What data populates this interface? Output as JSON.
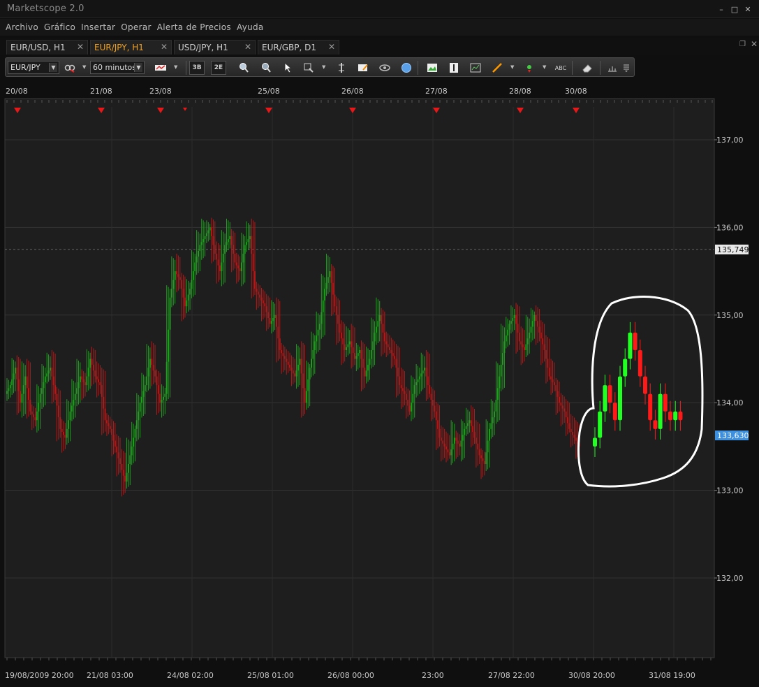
{
  "window": {
    "title": "Marketscope 2.0",
    "controls": [
      "–",
      "□",
      "✕"
    ]
  },
  "menu": [
    "Archivo",
    "Gráfico",
    "Insertar",
    "Operar",
    "Alerta de Precios",
    "Ayuda"
  ],
  "tabs": [
    {
      "label": "EUR/USD, H1",
      "active": false
    },
    {
      "label": "EUR/JPY, H1",
      "active": true
    },
    {
      "label": "USD/JPY, H1",
      "active": false
    },
    {
      "label": "EUR/GBP, D1",
      "active": false
    }
  ],
  "toolbar": {
    "instrument": "EUR/JPY",
    "timeframe": "60 minutos",
    "icons": [
      "link-icon",
      "candle-style-icon",
      "mode-1-icon",
      "mode-2-icon",
      "zoom-in-icon",
      "zoom-out-icon",
      "cursor-icon",
      "crosshair-icon",
      "data-box-icon",
      "note-icon",
      "eye-icon",
      "globe-icon",
      "image-icon",
      "text-icon",
      "indicator-icon",
      "pen-icon",
      "signal-icon",
      "abc-icon",
      "eraser-icon",
      "grid-icon",
      "menu-icon"
    ]
  },
  "chart_data": {
    "type": "candlestick",
    "instrument": "EUR/JPY",
    "timeframe": "H1",
    "ylim": [
      131.0,
      137.5
    ],
    "y_ticks": [
      "137,00",
      "136,00",
      "135,00",
      "134,00",
      "133,00",
      "132,00"
    ],
    "y_tick_values": [
      137.0,
      136.0,
      135.0,
      134.0,
      133.0,
      132.0
    ],
    "current_price_label": "133,630",
    "current_price": 133.63,
    "dashed_level_label": "135,749",
    "dashed_level": 135.749,
    "top_date_labels": [
      "20/08",
      "21/08",
      "23/08",
      "25/08",
      "26/08",
      "27/08",
      "28/08",
      "30/08"
    ],
    "bottom_time_labels": [
      "19/08/2009 20:00",
      "21/08 03:00",
      "24/08 02:00",
      "25/08 01:00",
      "26/08 00:00",
      "23:00",
      "27/08 22:00",
      "30/08 20:00",
      "31/08 19:00"
    ],
    "event_marker_count": 9,
    "colors": {
      "up": "#1f9e1f",
      "down": "#b01a1a",
      "bg": "#1e1e1e",
      "grid": "#333333",
      "highlight_up": "#22ff22",
      "highlight_down": "#ff1a1a",
      "circle": "#ffffff",
      "price_tag": "#3d8fe0"
    },
    "candles_closes": [
      134.2,
      134.4,
      134.0,
      134.3,
      133.9,
      133.8,
      134.1,
      134.3,
      134.4,
      134.1,
      133.7,
      133.6,
      133.9,
      134.1,
      134.3,
      134.2,
      134.5,
      134.3,
      134.2,
      133.8,
      133.7,
      133.5,
      133.3,
      133.1,
      133.4,
      133.7,
      134.0,
      134.2,
      134.5,
      134.3,
      134.0,
      134.1,
      135.2,
      135.5,
      135.4,
      135.1,
      135.3,
      135.6,
      135.8,
      135.9,
      136.0,
      135.7,
      135.5,
      135.8,
      135.9,
      135.6,
      135.5,
      135.8,
      135.9,
      135.3,
      135.2,
      135.1,
      134.9,
      135.0,
      134.6,
      134.5,
      134.4,
      134.3,
      134.5,
      134.0,
      134.4,
      134.7,
      134.9,
      135.3,
      135.5,
      135.1,
      134.8,
      134.6,
      134.7,
      134.5,
      134.6,
      134.3,
      134.5,
      134.8,
      135.0,
      134.7,
      134.6,
      134.5,
      134.2,
      134.1,
      133.9,
      134.2,
      134.3,
      134.4,
      134.1,
      133.9,
      133.6,
      133.5,
      133.4,
      133.6,
      133.5,
      133.7,
      133.8,
      133.6,
      133.4,
      133.3,
      133.7,
      133.9,
      134.3,
      134.7,
      134.9,
      135.0,
      134.7,
      134.6,
      134.8,
      135.0,
      134.8,
      134.6,
      134.3,
      134.2,
      134.0,
      133.9,
      133.7,
      133.6,
      133.5
    ],
    "highlighted_candles_closes": [
      133.6,
      133.9,
      134.2,
      134.0,
      133.8,
      134.3,
      134.5,
      134.8,
      134.6,
      134.3,
      134.1,
      133.8,
      133.7,
      134.1,
      133.9,
      133.8,
      133.9,
      133.8
    ]
  }
}
